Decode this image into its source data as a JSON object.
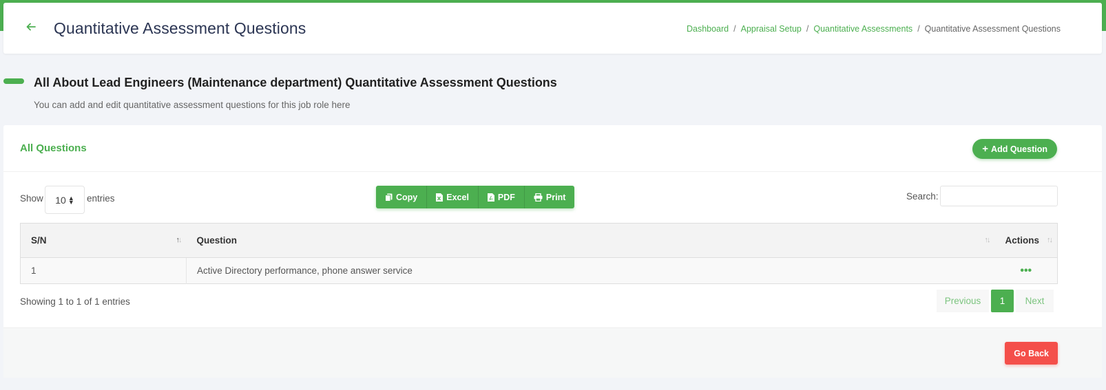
{
  "header": {
    "title": "Quantitative Assessment Questions",
    "breadcrumb": {
      "items": [
        "Dashboard",
        "Appraisal Setup",
        "Quantitative Assessments"
      ],
      "separator": "/",
      "current": "Quantitative Assessment Questions"
    }
  },
  "section": {
    "title": "All About Lead Engineers (Maintenance department) Quantitative Assessment Questions",
    "subtitle": "You can add and edit quantitative assessment questions for this job role here"
  },
  "card": {
    "title": "All Questions",
    "add_button": "Add Question"
  },
  "controls": {
    "show_label": "Show",
    "entries_value": "10",
    "entries_label": "entries",
    "export_buttons": {
      "copy": "Copy",
      "excel": "Excel",
      "pdf": "PDF",
      "print": "Print"
    },
    "search_label": "Search:",
    "search_value": ""
  },
  "table": {
    "columns": {
      "sn": "S/N",
      "question": "Question",
      "actions": "Actions"
    },
    "rows": [
      {
        "sn": "1",
        "question": "Active Directory performance, phone answer service",
        "actions": "•••"
      }
    ]
  },
  "footer": {
    "showing": "Showing 1 to 1 of 1 entries",
    "pagination": {
      "previous": "Previous",
      "current": "1",
      "next": "Next"
    },
    "go_back": "Go Back"
  },
  "colors": {
    "accent": "#4caf50",
    "danger": "#f44f4a",
    "title": "#2b3553"
  },
  "icons": {
    "back": "arrow-left-icon",
    "add": "plus-icon",
    "copy": "copy-icon",
    "excel": "file-excel-icon",
    "pdf": "file-pdf-icon",
    "print": "print-icon",
    "select": "sort-arrows-icon",
    "row_actions": "ellipsis-icon"
  }
}
